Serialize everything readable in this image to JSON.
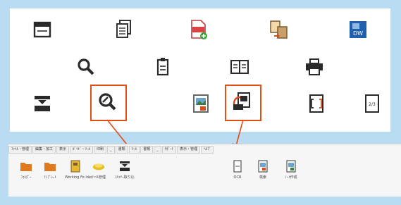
{
  "icons": [
    {
      "name": "window-icon"
    },
    {
      "name": "document-stack-icon"
    },
    {
      "name": "pdf-add-icon"
    },
    {
      "name": "file-transfer-icon"
    },
    {
      "name": "dw-app-icon",
      "label": "DW"
    },
    {
      "name": "search-icon"
    },
    {
      "name": "clipboard-icon"
    },
    {
      "name": "book-icon"
    },
    {
      "name": "printer-icon"
    },
    {
      "name": "scanner-icon"
    },
    {
      "name": "zoom-icon"
    },
    {
      "name": "image-document-icon"
    },
    {
      "name": "document-rotate-icon"
    },
    {
      "name": "document-bracket-icon"
    },
    {
      "name": "page-icon",
      "label": "2/3"
    }
  ],
  "colors": {
    "background": "#b9dcf2",
    "highlight": "#e04e16",
    "folder": "#e07a1c",
    "dw_blue": "#1f5fae"
  },
  "ribbon": {
    "tabs": [
      "ﾌｧｲﾙ・管理",
      "編集・加工",
      "表示",
      "ｶﾞｲﾄﾞ・ﾂｰﾙ",
      "印刷",
      "_",
      "書類",
      "ﾂｰﾙ",
      "書類",
      "_",
      "ｻﾎﾟｰﾄ",
      "表示・管理",
      "ﾍﾙﾌﾟ"
    ],
    "buttons": [
      {
        "icon": "folder-icon",
        "label": "ﾌｫﾙﾀﾞｰ"
      },
      {
        "icon": "folder-icon",
        "label": "ﾃﾝﾌﾟﾚｰﾄ"
      },
      {
        "icon": "binder-icon",
        "label": "Working Fo lder"
      },
      {
        "icon": "scan-disc-icon",
        "label": "ﾌｧｲﾙ管理"
      },
      {
        "icon": "scanner-icon",
        "label": "ｽｷｬﾅｰ取り込"
      },
      {
        "icon": "document-bracket-icon",
        "label": "OCR"
      },
      {
        "icon": "image-document-icon",
        "label": "検索"
      },
      {
        "icon": "image-document-icon",
        "label": "ﾉｰﾄ作成"
      }
    ]
  }
}
